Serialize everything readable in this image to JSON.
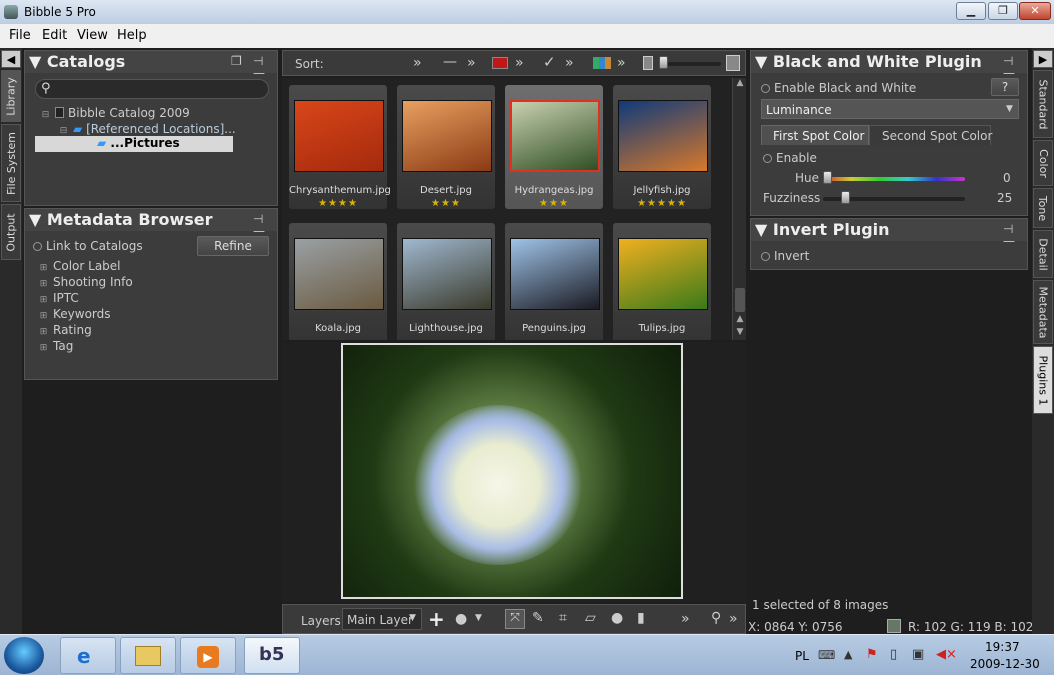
{
  "window": {
    "title": "Bibble 5 Pro",
    "minimize": "▁",
    "maximize": "❐",
    "close": "✕"
  },
  "menu": [
    "File",
    "Edit",
    "View",
    "Help"
  ],
  "left_tabs": [
    "Library",
    "File System",
    "Output"
  ],
  "right_tabs": [
    "Standard",
    "Color",
    "Tone",
    "Detail",
    "Metadata",
    "Plugins 1"
  ],
  "catalogs": {
    "title": "Catalogs",
    "search_placeholder": "",
    "tree": [
      "Bibble Catalog 2009",
      "[Referenced Locations]...",
      "...Pictures"
    ]
  },
  "metadata_browser": {
    "title": "Metadata Browser",
    "link_label": "Link to Catalogs",
    "refine": "Refine",
    "items": [
      "Color Label",
      "Shooting Info",
      "IPTC",
      "Keywords",
      "Rating",
      "Tag"
    ]
  },
  "toolbar": {
    "sort_label": "Sort:",
    "more": "»"
  },
  "thumbnails": [
    {
      "name": "Chrysanthemum.jpg",
      "stars": "★★★★",
      "colors": [
        "#d9461a",
        "#a42a0c"
      ]
    },
    {
      "name": "Desert.jpg",
      "stars": "★★★",
      "colors": [
        "#e9a060",
        "#8a3a14"
      ]
    },
    {
      "name": "Hydrangeas.jpg",
      "stars": "★★★",
      "colors": [
        "#c8d0b0",
        "#2f4f24"
      ]
    },
    {
      "name": "Jellyfish.jpg",
      "stars": "★★★★★",
      "colors": [
        "#0f3a7a",
        "#d8792a"
      ]
    },
    {
      "name": "Koala.jpg",
      "stars": "",
      "colors": [
        "#9aa0a4",
        "#6a5a40"
      ]
    },
    {
      "name": "Lighthouse.jpg",
      "stars": "",
      "colors": [
        "#a0b8d0",
        "#3a3a2a"
      ]
    },
    {
      "name": "Penguins.jpg",
      "stars": "",
      "colors": [
        "#9fc3e8",
        "#1a1a22"
      ]
    },
    {
      "name": "Tulips.jpg",
      "stars": "",
      "colors": [
        "#f0b020",
        "#3a7a1a"
      ]
    }
  ],
  "bottom_toolbar": {
    "layers": "Layers",
    "layer": "Main Layer",
    "more": "»"
  },
  "bw_plugin": {
    "title": "Black and White Plugin",
    "enable": "Enable Black and White",
    "help": "?",
    "mode": "Luminance",
    "tabs": [
      "First Spot Color",
      "Second Spot Color"
    ],
    "spot_enable": "Enable",
    "hue_label": "Hue",
    "hue_value": "0",
    "fuzziness_label": "Fuzziness",
    "fuzziness_value": "25"
  },
  "invert_plugin": {
    "title": "Invert Plugin",
    "invert": "Invert"
  },
  "status": {
    "selection": "1 selected of 8 images",
    "xy": "X: 0864  Y: 0756",
    "rgb": "R:  102   G:  119   B:  102"
  },
  "taskbar": {
    "lang": "PL",
    "time": "19:37",
    "date": "2009-12-30"
  }
}
